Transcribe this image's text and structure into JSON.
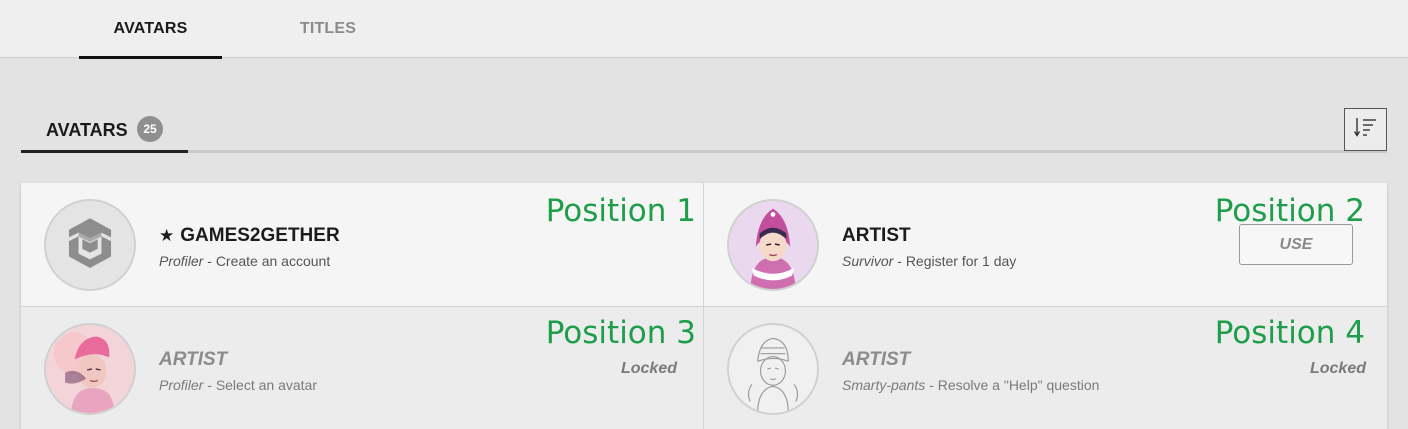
{
  "tabs": [
    {
      "label": "AVATARS",
      "active": true
    },
    {
      "label": "TITLES",
      "active": false
    }
  ],
  "section": {
    "title": "AVATARS",
    "count": "25"
  },
  "sort_icon": "sort-descending-icon",
  "colors": {
    "annotation": "#1e9e4a",
    "accent": "#111111",
    "badge": "#8f8f8f"
  },
  "cards": [
    {
      "name": "GAMES2GETHER",
      "starred": true,
      "category": "Profiler",
      "separator": " - ",
      "requirement": "Create an account",
      "annotation": "Position 1",
      "state": "active",
      "avatar": "games2gether-logo"
    },
    {
      "name": "ARTIST",
      "starred": false,
      "category": "Survivor",
      "separator": " - ",
      "requirement": "Register for 1 day",
      "annotation": "Position 2",
      "state": "unlocked",
      "action": "USE",
      "avatar": "character-pink-hood"
    },
    {
      "name": "ARTIST",
      "starred": false,
      "category": "Profiler",
      "separator": " - ",
      "requirement": "Select an avatar",
      "annotation": "Position 3",
      "state": "locked",
      "locked_label": "Locked",
      "avatar": "character-pink-beanie"
    },
    {
      "name": "ARTIST",
      "starred": false,
      "category": "Smarty-pants",
      "separator": " - ",
      "requirement": "Resolve a \"Help\" question",
      "annotation": "Position 4",
      "state": "locked",
      "locked_label": "Locked",
      "avatar": "character-sketch"
    }
  ]
}
